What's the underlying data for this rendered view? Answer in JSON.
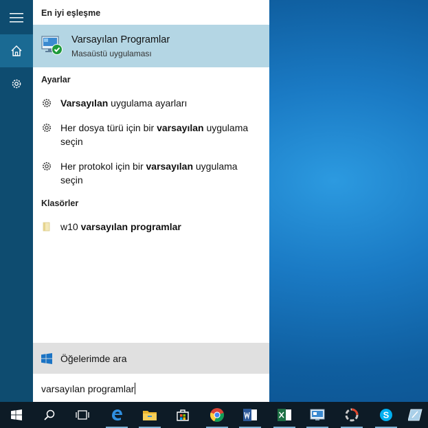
{
  "best_match": {
    "title": "En iyi eşleşme",
    "name": "Varsayılan Programlar",
    "subtitle": "Masaüstü uygulaması"
  },
  "settings": {
    "title": "Ayarlar",
    "items": [
      {
        "bold": "Varsayılan",
        "rest": " uygulama ayarları"
      },
      {
        "pre": "Her dosya türü için bir ",
        "bold": "varsayılan",
        "rest": " uygulama seçin"
      },
      {
        "pre": "Her protokol için bir ",
        "bold": "varsayılan",
        "rest": " uygulama seçin"
      }
    ]
  },
  "folders": {
    "title": "Klasörler",
    "items": [
      {
        "pre": "w10 ",
        "bold": "varsayılan programlar"
      }
    ]
  },
  "search_mine_label": "Öğelerimde ara",
  "query": "varsayılan programlar",
  "taskbar_icons": [
    "start-icon",
    "search-icon",
    "task-view-icon",
    "edge-icon",
    "file-explorer-icon",
    "store-icon",
    "chrome-icon",
    "word-icon",
    "excel-icon",
    "control-panel-icon",
    "app-icon",
    "skype-icon",
    "pen-icon"
  ],
  "colors": {
    "rail": "#0e4c70",
    "best_match_bg": "#b4d6e4",
    "taskbar": "#0d1b26"
  }
}
